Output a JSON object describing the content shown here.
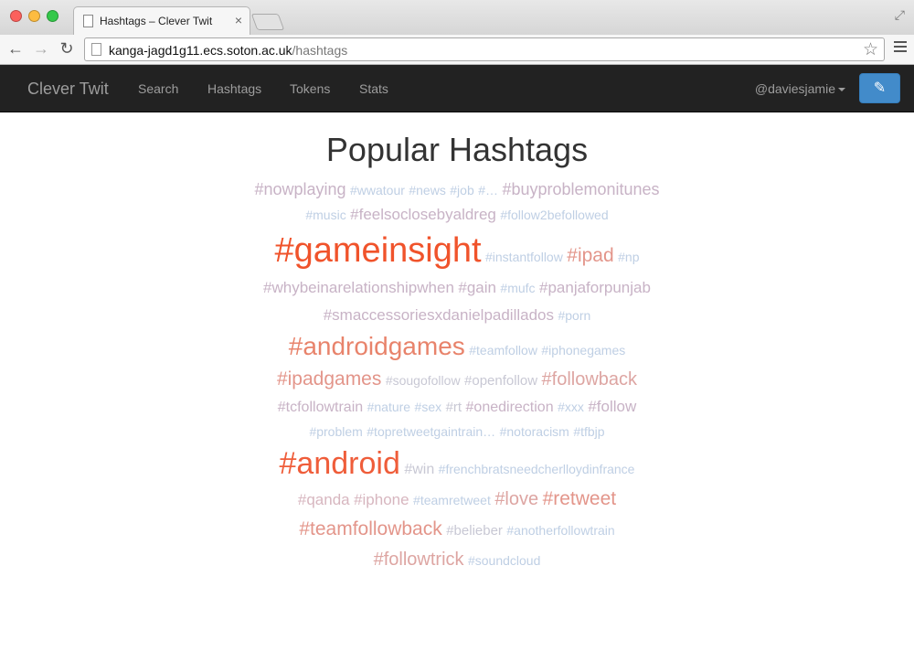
{
  "browser": {
    "tab_title": "Hashtags – Clever Twit",
    "tab_close": "×",
    "url_host": "kanga-jagd1g11.ecs.soton.ac.uk",
    "url_path": "/hashtags",
    "back": "←",
    "forward": "→",
    "reload": "↻",
    "star": "☆",
    "fullscreen": "⤢"
  },
  "navbar": {
    "brand": "Clever Twit",
    "links": [
      "Search",
      "Hashtags",
      "Tokens",
      "Stats"
    ],
    "user": "@daviesjamie",
    "compose_icon": "✎"
  },
  "page": {
    "title": "Popular Hashtags"
  },
  "cloud": [
    [
      {
        "text": "#nowplaying",
        "size": 18,
        "color": "#c8b3c6"
      },
      {
        "text": "#wwatour",
        "size": 14,
        "color": "#bfcfe4"
      },
      {
        "text": "#news",
        "size": 14,
        "color": "#bfcfe4"
      },
      {
        "text": "#job",
        "size": 14,
        "color": "#bfcfe4"
      },
      {
        "text": "#…",
        "size": 14,
        "color": "#bfcfe4"
      },
      {
        "text": "#buyproblemonitunes",
        "size": 18,
        "color": "#c8b3c6"
      }
    ],
    [
      {
        "text": "#music",
        "size": 14,
        "color": "#bfcfe4"
      },
      {
        "text": "#feelsoclosebyaldreg",
        "size": 17,
        "color": "#c8b3c6"
      },
      {
        "text": "#follow2befollowed",
        "size": 14,
        "color": "#bfcfe4"
      }
    ],
    [
      {
        "text": "#gameinsight",
        "size": 38,
        "color": "#f0532b"
      },
      {
        "text": "#instantfollow",
        "size": 14,
        "color": "#bfcfe4"
      },
      {
        "text": "#ipad",
        "size": 21,
        "color": "#e3958a"
      },
      {
        "text": "#np",
        "size": 14,
        "color": "#bfcfe4"
      }
    ],
    [
      {
        "text": "#whybeinarelationshipwhen",
        "size": 17,
        "color": "#c8b3c6"
      },
      {
        "text": "#gain",
        "size": 17,
        "color": "#c8b3c6"
      },
      {
        "text": "#mufc",
        "size": 14,
        "color": "#bfcfe4"
      },
      {
        "text": "#panjaforpunjab",
        "size": 17,
        "color": "#c8b3c6"
      }
    ],
    [
      {
        "text": "#smaccessoriesxdanielpadillados",
        "size": 17,
        "color": "#c8b3c6"
      },
      {
        "text": "#porn",
        "size": 14,
        "color": "#bfcfe4"
      }
    ],
    [
      {
        "text": "#androidgames",
        "size": 28,
        "color": "#e8836b"
      },
      {
        "text": "#teamfollow",
        "size": 14,
        "color": "#bfcfe4"
      },
      {
        "text": "#iphonegames",
        "size": 14,
        "color": "#bfcfe4"
      }
    ],
    [
      {
        "text": "#ipadgames",
        "size": 21,
        "color": "#e3958a"
      },
      {
        "text": "#sougofollow",
        "size": 14,
        "color": "#c8c8d4"
      },
      {
        "text": "#openfollow",
        "size": 15,
        "color": "#c8c8d4"
      },
      {
        "text": "#followback",
        "size": 20,
        "color": "#dda5a2"
      }
    ],
    [
      {
        "text": "#tcfollowtrain",
        "size": 16,
        "color": "#c8b3c6"
      },
      {
        "text": "#nature",
        "size": 14,
        "color": "#bfcfe4"
      },
      {
        "text": "#sex",
        "size": 14,
        "color": "#bfcfe4"
      },
      {
        "text": "#rt",
        "size": 15,
        "color": "#c8c8d4"
      },
      {
        "text": "#onedirection",
        "size": 16,
        "color": "#c8b3c6"
      },
      {
        "text": "#xxx",
        "size": 14,
        "color": "#bfcfe4"
      },
      {
        "text": "#follow",
        "size": 17,
        "color": "#c8b3c6"
      }
    ],
    [
      {
        "text": "#problem",
        "size": 14,
        "color": "#bfcfe4"
      },
      {
        "text": "#topretweetgaintrain…",
        "size": 14,
        "color": "#bfcfe4"
      },
      {
        "text": "#notoracism",
        "size": 14,
        "color": "#bfcfe4"
      },
      {
        "text": "#tfbjp",
        "size": 14,
        "color": "#bfcfe4"
      }
    ],
    [
      {
        "text": "#android",
        "size": 34,
        "color": "#ef5d3a"
      },
      {
        "text": "#win",
        "size": 16,
        "color": "#c8c8d4"
      },
      {
        "text": "#frenchbratsneedcherlloydinfrance",
        "size": 14,
        "color": "#bfcfe4"
      }
    ],
    [
      {
        "text": "#qanda",
        "size": 17,
        "color": "#d7b6bf"
      },
      {
        "text": "#iphone",
        "size": 17,
        "color": "#d7b6bf"
      },
      {
        "text": "#teamretweet",
        "size": 14,
        "color": "#bfcfe4"
      },
      {
        "text": "#love",
        "size": 20,
        "color": "#dda5a2"
      },
      {
        "text": "#retweet",
        "size": 21,
        "color": "#e3958a"
      }
    ],
    [
      {
        "text": "#teamfollowback",
        "size": 21,
        "color": "#e3958a"
      },
      {
        "text": "#belieber",
        "size": 15,
        "color": "#c8c8d4"
      },
      {
        "text": "#anotherfollowtrain",
        "size": 14,
        "color": "#bfcfe4"
      }
    ],
    [
      {
        "text": "#followtrick",
        "size": 20,
        "color": "#dda5a2"
      },
      {
        "text": "#soundcloud",
        "size": 14,
        "color": "#bfcfe4"
      }
    ]
  ]
}
